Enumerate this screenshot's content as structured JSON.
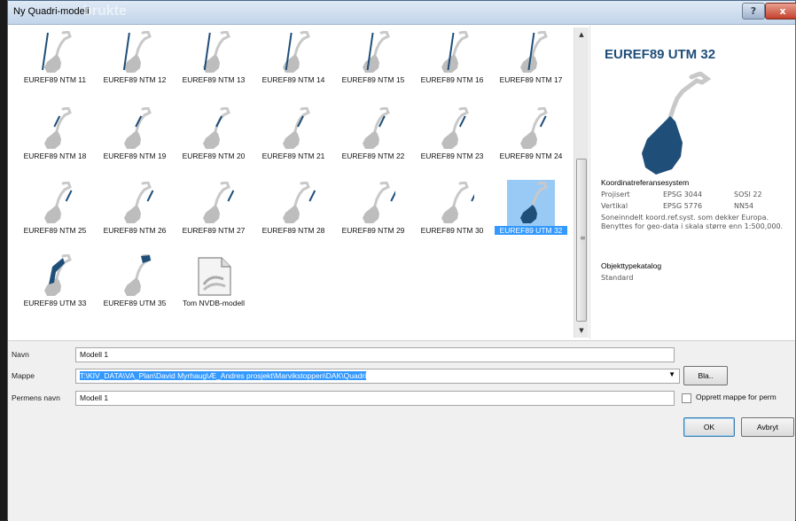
{
  "window": {
    "title": "Ny Quadri-modell",
    "title_ghost": "brukte",
    "help_label": "?",
    "close_label": "x"
  },
  "gallery": {
    "tiles": [
      {
        "label": "EUREF89 NTM 11",
        "icon": "norway-map-icon",
        "selected": false
      },
      {
        "label": "EUREF89 NTM 12",
        "icon": "norway-map-icon",
        "selected": false
      },
      {
        "label": "EUREF89 NTM 13",
        "icon": "norway-map-icon",
        "selected": false
      },
      {
        "label": "EUREF89 NTM 14",
        "icon": "norway-map-icon",
        "selected": false
      },
      {
        "label": "EUREF89 NTM 15",
        "icon": "norway-map-icon",
        "selected": false
      },
      {
        "label": "EUREF89 NTM 16",
        "icon": "norway-map-icon",
        "selected": false
      },
      {
        "label": "EUREF89 NTM 17",
        "icon": "norway-map-icon",
        "selected": false
      },
      {
        "label": "EUREF89 NTM 18",
        "icon": "norway-map-icon",
        "selected": false
      },
      {
        "label": "EUREF89 NTM 19",
        "icon": "norway-map-icon",
        "selected": false
      },
      {
        "label": "EUREF89 NTM 20",
        "icon": "norway-map-icon",
        "selected": false
      },
      {
        "label": "EUREF89 NTM 21",
        "icon": "norway-map-icon",
        "selected": false
      },
      {
        "label": "EUREF89 NTM 22",
        "icon": "norway-map-icon",
        "selected": false
      },
      {
        "label": "EUREF89 NTM 23",
        "icon": "norway-map-icon",
        "selected": false
      },
      {
        "label": "EUREF89 NTM 24",
        "icon": "norway-map-icon",
        "selected": false
      },
      {
        "label": "EUREF89 NTM 25",
        "icon": "norway-map-icon",
        "selected": false
      },
      {
        "label": "EUREF89 NTM 26",
        "icon": "norway-map-icon",
        "selected": false
      },
      {
        "label": "EUREF89 NTM 27",
        "icon": "norway-map-icon",
        "selected": false
      },
      {
        "label": "EUREF89 NTM 28",
        "icon": "norway-map-icon",
        "selected": false
      },
      {
        "label": "EUREF89 NTM 29",
        "icon": "norway-map-icon",
        "selected": false
      },
      {
        "label": "EUREF89 NTM 30",
        "icon": "norway-map-icon",
        "selected": false
      },
      {
        "label": "EUREF89 UTM 32",
        "icon": "norway-map-icon",
        "selected": true
      },
      {
        "label": "EUREF89 UTM 33",
        "icon": "norway-map-icon",
        "selected": false
      },
      {
        "label": "EUREF89 UTM 35",
        "icon": "norway-map-icon",
        "selected": false
      },
      {
        "label": "Tom NVDB-modell",
        "icon": "blank-document-icon",
        "selected": false
      }
    ]
  },
  "detail": {
    "title": "EUREF89 UTM 32",
    "crs_heading": "Koordinatreferansesystem",
    "projected": {
      "label": "Projisert",
      "epsg": "EPSG 3044",
      "code": "SOSI 22"
    },
    "vertical": {
      "label": "Vertikal",
      "epsg": "EPSG 5776",
      "code": "NN54"
    },
    "description": "Soneinndelt koord.ref.syst. som dekker Europa. Benyttes for geo-data i skala større enn 1:500,000.",
    "catalog_heading": "Objekttypekatalog",
    "catalog_value": "Standard"
  },
  "form": {
    "name_label": "Navn",
    "name_value": "Modell 1",
    "folder_label": "Mappe",
    "folder_value": "T:\\KIV_DATA\\VA_Plan\\David Myrhaug\\Æ_Andres prosjekt\\Marvikstoppen\\DAK\\Quadri",
    "browse_label": "Bla..",
    "perm_label": "Permens navn",
    "perm_value": "Modell 1",
    "create_folder_label": "Opprett mappe for perm",
    "ok_label": "OK",
    "cancel_label": "Avbryt"
  },
  "colors": {
    "selection": "#3399ff",
    "zone_highlight": "#1f4e79",
    "title_accent": "#1f4e79"
  }
}
